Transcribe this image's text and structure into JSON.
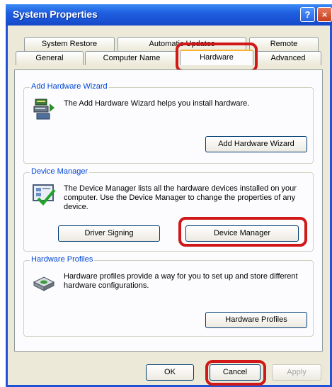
{
  "window": {
    "title": "System Properties",
    "help_glyph": "?",
    "close_glyph": "×"
  },
  "tabs": {
    "row_back": [
      "System Restore",
      "Automatic Updates",
      "Remote"
    ],
    "row_front": [
      "General",
      "Computer Name",
      "Hardware",
      "Advanced"
    ],
    "active": "Hardware"
  },
  "add_hardware": {
    "legend": "Add Hardware Wizard",
    "description": "The Add Hardware Wizard helps you install hardware.",
    "button": "Add Hardware Wizard"
  },
  "device_manager": {
    "legend": "Device Manager",
    "description": "The Device Manager lists all the hardware devices installed on your computer. Use the Device Manager to change the properties of any device.",
    "driver_button": "Driver Signing",
    "button": "Device Manager"
  },
  "hardware_profiles": {
    "legend": "Hardware Profiles",
    "description": "Hardware profiles provide a way for you to set up and store different hardware configurations.",
    "button": "Hardware Profiles"
  },
  "footer": {
    "ok": "OK",
    "cancel": "Cancel",
    "apply": "Apply"
  },
  "colors": {
    "titlebar": "#1f5fe0",
    "highlight": "#d01818",
    "legend": "#0046d5"
  }
}
